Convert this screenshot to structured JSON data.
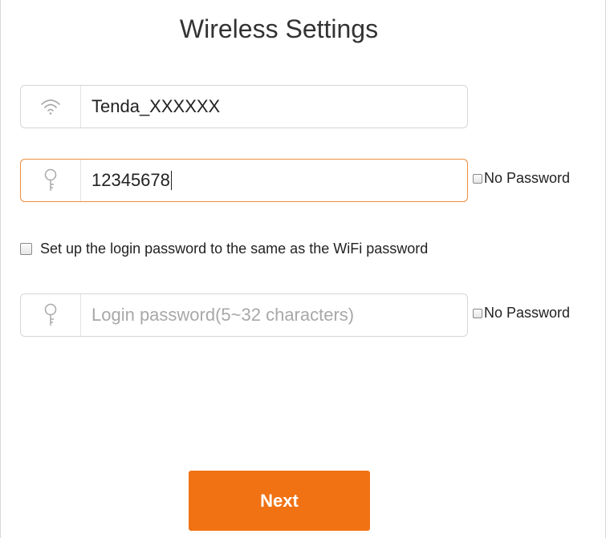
{
  "page": {
    "title": "Wireless Settings"
  },
  "wifi_name": {
    "icon": "wifi-icon",
    "value": "Tenda_XXXXXX"
  },
  "wifi_password": {
    "icon": "key-icon",
    "value": "12345678",
    "no_password_label": "No Password"
  },
  "same_as_wifi": {
    "label": "Set up the login password to the same as the WiFi password"
  },
  "login_password": {
    "icon": "key-icon",
    "placeholder": "Login password(5~32 characters)",
    "no_password_label": "No Password"
  },
  "next_button": {
    "label": "Next"
  },
  "colors": {
    "accent": "#f07213",
    "focus_border": "#f08c3a"
  }
}
